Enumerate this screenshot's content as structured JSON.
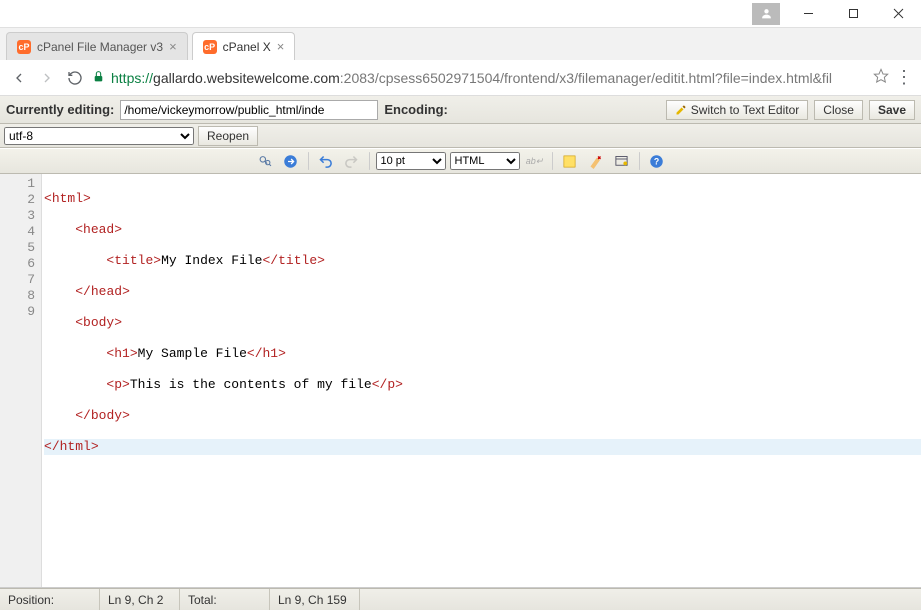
{
  "titlebar": {},
  "tabs": [
    {
      "label": "cPanel File Manager v3",
      "active": false
    },
    {
      "label": "cPanel X",
      "active": true
    }
  ],
  "url": {
    "scheme": "https",
    "host": "gallardo.websitewelcome.com",
    "rest": ":2083/cpsess6502971504/frontend/x3/filemanager/editit.html?file=index.html&fil"
  },
  "editorbar": {
    "currently_editing_label": "Currently editing:",
    "path_value": "/home/vickeymorrow/public_html/inde",
    "encoding_label": "Encoding:",
    "switch_label": "Switch to Text Editor",
    "close_label": "Close",
    "save_label": "Save"
  },
  "encoding": {
    "value": "utf-8",
    "reopen_label": "Reopen"
  },
  "toolbar": {
    "font_size": "10 pt",
    "syntax": "HTML"
  },
  "code": {
    "lines": {
      "l1": {
        "open_name": "html"
      },
      "l2": {
        "open_name": "head"
      },
      "l3": {
        "open_name": "title",
        "text": "My Index File",
        "close_name": "title"
      },
      "l4": {
        "close_name": "head"
      },
      "l5": {
        "open_name": "body"
      },
      "l6": {
        "open_name": "h1",
        "text": "My Sample File",
        "close_name": "h1"
      },
      "l7": {
        "open_name": "p",
        "text": "This is the contents of my file",
        "close_name": "p"
      },
      "l8": {
        "close_name": "body"
      },
      "l9": {
        "close_name": "html"
      }
    },
    "gutter": {
      "n1": "1",
      "n2": "2",
      "n3": "3",
      "n4": "4",
      "n5": "5",
      "n6": "6",
      "n7": "7",
      "n8": "8",
      "n9": "9"
    }
  },
  "status": {
    "position_label": "Position:",
    "position_value": "Ln 9, Ch 2",
    "total_label": "Total:",
    "total_value": "Ln 9, Ch 159"
  }
}
